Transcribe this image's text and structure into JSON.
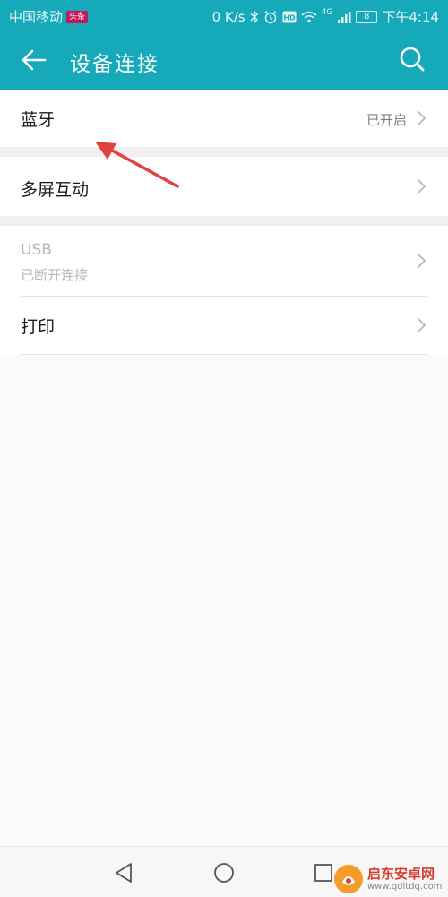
{
  "status_bar": {
    "carrier": "中国移动",
    "carrier_badge": "头条",
    "network_speed": "0 K/s",
    "network_type": "4G",
    "battery_level": "8",
    "time": "下午4:14"
  },
  "app_bar": {
    "title": "设备连接"
  },
  "settings": {
    "bluetooth": {
      "label": "蓝牙",
      "status": "已开启"
    },
    "multi_screen": {
      "label": "多屏互动"
    },
    "usb": {
      "label": "USB",
      "status": "已断开连接"
    },
    "print": {
      "label": "打印"
    }
  },
  "watermark": {
    "name": "启东安卓网",
    "url": "www.qdltdq.com"
  },
  "colors": {
    "header": "#16a9ba",
    "annotation_arrow": "#e0433b"
  }
}
